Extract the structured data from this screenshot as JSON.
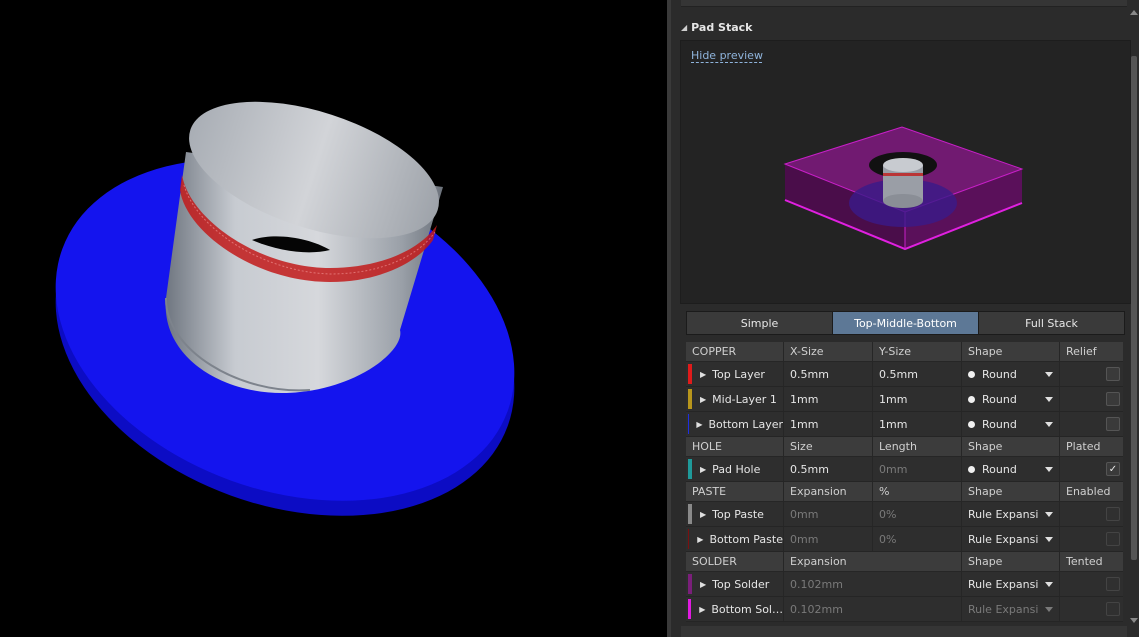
{
  "panel": {
    "section_title": "Pad Stack",
    "hide_preview": "Hide preview",
    "tabs": [
      {
        "label": "Simple",
        "active": false
      },
      {
        "label": "Top-Middle-Bottom",
        "active": true
      },
      {
        "label": "Full Stack",
        "active": false
      }
    ]
  },
  "groups": {
    "copper": {
      "headers": [
        "COPPER",
        "X-Size",
        "Y-Size",
        "Shape",
        "Relief"
      ],
      "rows": [
        {
          "name": "Top Layer",
          "color": "#e01b1b",
          "x": "0.5mm",
          "y": "0.5mm",
          "shape": "Round",
          "checked": false
        },
        {
          "name": "Mid-Layer 1",
          "color": "#b8961c",
          "x": "1mm",
          "y": "1mm",
          "shape": "Round",
          "checked": false
        },
        {
          "name": "Bottom Layer",
          "color": "#1f2fe0",
          "x": "1mm",
          "y": "1mm",
          "shape": "Round",
          "checked": false
        }
      ]
    },
    "hole": {
      "headers": [
        "HOLE",
        "Size",
        "Length",
        "Shape",
        "Plated"
      ],
      "rows": [
        {
          "name": "Pad Hole",
          "color": "#1f9a9a",
          "x": "0.5mm",
          "y": "0mm",
          "shape": "Round",
          "checked": true
        }
      ]
    },
    "paste": {
      "headers": [
        "PASTE",
        "Expansion",
        "%",
        "Shape",
        "Enabled"
      ],
      "rows": [
        {
          "name": "Top Paste",
          "color": "#8a8a8a",
          "x": "0mm",
          "y": "0%",
          "shape": "Rule Expansi",
          "checked": false
        },
        {
          "name": "Bottom Paste",
          "color": "#7a1010",
          "x": "0mm",
          "y": "0%",
          "shape": "Rule Expansi",
          "checked": false
        }
      ]
    },
    "solder": {
      "headers": [
        "SOLDER",
        "Expansion",
        "",
        "Shape",
        "Tented"
      ],
      "rows": [
        {
          "name": "Top Solder",
          "color": "#7a1f7a",
          "x": "0.102mm",
          "y": "",
          "shape": "Rule Expansi",
          "checked": false
        },
        {
          "name": "Bottom Sol…",
          "color": "#e01be0",
          "x": "0.102mm",
          "y": "",
          "shape": "Rule Expansi",
          "checked": false
        }
      ]
    }
  },
  "colors": {
    "accent_tab": "#5d7896",
    "pad_blue": "#1414e6",
    "barrel_gray": "#b9bdc4",
    "preview_magenta": "#c81fc8"
  }
}
